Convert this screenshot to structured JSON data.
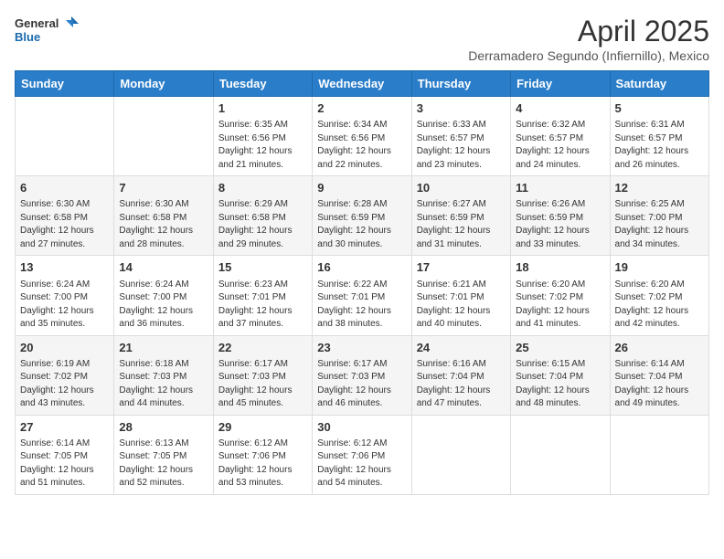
{
  "logo": {
    "general": "General",
    "blue": "Blue"
  },
  "title": "April 2025",
  "subtitle": "Derramadero Segundo (Infiernillo), Mexico",
  "headers": [
    "Sunday",
    "Monday",
    "Tuesday",
    "Wednesday",
    "Thursday",
    "Friday",
    "Saturday"
  ],
  "weeks": [
    [
      {
        "day": "",
        "info": ""
      },
      {
        "day": "",
        "info": ""
      },
      {
        "day": "1",
        "info": "Sunrise: 6:35 AM\nSunset: 6:56 PM\nDaylight: 12 hours and 21 minutes."
      },
      {
        "day": "2",
        "info": "Sunrise: 6:34 AM\nSunset: 6:56 PM\nDaylight: 12 hours and 22 minutes."
      },
      {
        "day": "3",
        "info": "Sunrise: 6:33 AM\nSunset: 6:57 PM\nDaylight: 12 hours and 23 minutes."
      },
      {
        "day": "4",
        "info": "Sunrise: 6:32 AM\nSunset: 6:57 PM\nDaylight: 12 hours and 24 minutes."
      },
      {
        "day": "5",
        "info": "Sunrise: 6:31 AM\nSunset: 6:57 PM\nDaylight: 12 hours and 26 minutes."
      }
    ],
    [
      {
        "day": "6",
        "info": "Sunrise: 6:30 AM\nSunset: 6:58 PM\nDaylight: 12 hours and 27 minutes."
      },
      {
        "day": "7",
        "info": "Sunrise: 6:30 AM\nSunset: 6:58 PM\nDaylight: 12 hours and 28 minutes."
      },
      {
        "day": "8",
        "info": "Sunrise: 6:29 AM\nSunset: 6:58 PM\nDaylight: 12 hours and 29 minutes."
      },
      {
        "day": "9",
        "info": "Sunrise: 6:28 AM\nSunset: 6:59 PM\nDaylight: 12 hours and 30 minutes."
      },
      {
        "day": "10",
        "info": "Sunrise: 6:27 AM\nSunset: 6:59 PM\nDaylight: 12 hours and 31 minutes."
      },
      {
        "day": "11",
        "info": "Sunrise: 6:26 AM\nSunset: 6:59 PM\nDaylight: 12 hours and 33 minutes."
      },
      {
        "day": "12",
        "info": "Sunrise: 6:25 AM\nSunset: 7:00 PM\nDaylight: 12 hours and 34 minutes."
      }
    ],
    [
      {
        "day": "13",
        "info": "Sunrise: 6:24 AM\nSunset: 7:00 PM\nDaylight: 12 hours and 35 minutes."
      },
      {
        "day": "14",
        "info": "Sunrise: 6:24 AM\nSunset: 7:00 PM\nDaylight: 12 hours and 36 minutes."
      },
      {
        "day": "15",
        "info": "Sunrise: 6:23 AM\nSunset: 7:01 PM\nDaylight: 12 hours and 37 minutes."
      },
      {
        "day": "16",
        "info": "Sunrise: 6:22 AM\nSunset: 7:01 PM\nDaylight: 12 hours and 38 minutes."
      },
      {
        "day": "17",
        "info": "Sunrise: 6:21 AM\nSunset: 7:01 PM\nDaylight: 12 hours and 40 minutes."
      },
      {
        "day": "18",
        "info": "Sunrise: 6:20 AM\nSunset: 7:02 PM\nDaylight: 12 hours and 41 minutes."
      },
      {
        "day": "19",
        "info": "Sunrise: 6:20 AM\nSunset: 7:02 PM\nDaylight: 12 hours and 42 minutes."
      }
    ],
    [
      {
        "day": "20",
        "info": "Sunrise: 6:19 AM\nSunset: 7:02 PM\nDaylight: 12 hours and 43 minutes."
      },
      {
        "day": "21",
        "info": "Sunrise: 6:18 AM\nSunset: 7:03 PM\nDaylight: 12 hours and 44 minutes."
      },
      {
        "day": "22",
        "info": "Sunrise: 6:17 AM\nSunset: 7:03 PM\nDaylight: 12 hours and 45 minutes."
      },
      {
        "day": "23",
        "info": "Sunrise: 6:17 AM\nSunset: 7:03 PM\nDaylight: 12 hours and 46 minutes."
      },
      {
        "day": "24",
        "info": "Sunrise: 6:16 AM\nSunset: 7:04 PM\nDaylight: 12 hours and 47 minutes."
      },
      {
        "day": "25",
        "info": "Sunrise: 6:15 AM\nSunset: 7:04 PM\nDaylight: 12 hours and 48 minutes."
      },
      {
        "day": "26",
        "info": "Sunrise: 6:14 AM\nSunset: 7:04 PM\nDaylight: 12 hours and 49 minutes."
      }
    ],
    [
      {
        "day": "27",
        "info": "Sunrise: 6:14 AM\nSunset: 7:05 PM\nDaylight: 12 hours and 51 minutes."
      },
      {
        "day": "28",
        "info": "Sunrise: 6:13 AM\nSunset: 7:05 PM\nDaylight: 12 hours and 52 minutes."
      },
      {
        "day": "29",
        "info": "Sunrise: 6:12 AM\nSunset: 7:06 PM\nDaylight: 12 hours and 53 minutes."
      },
      {
        "day": "30",
        "info": "Sunrise: 6:12 AM\nSunset: 7:06 PM\nDaylight: 12 hours and 54 minutes."
      },
      {
        "day": "",
        "info": ""
      },
      {
        "day": "",
        "info": ""
      },
      {
        "day": "",
        "info": ""
      }
    ]
  ]
}
